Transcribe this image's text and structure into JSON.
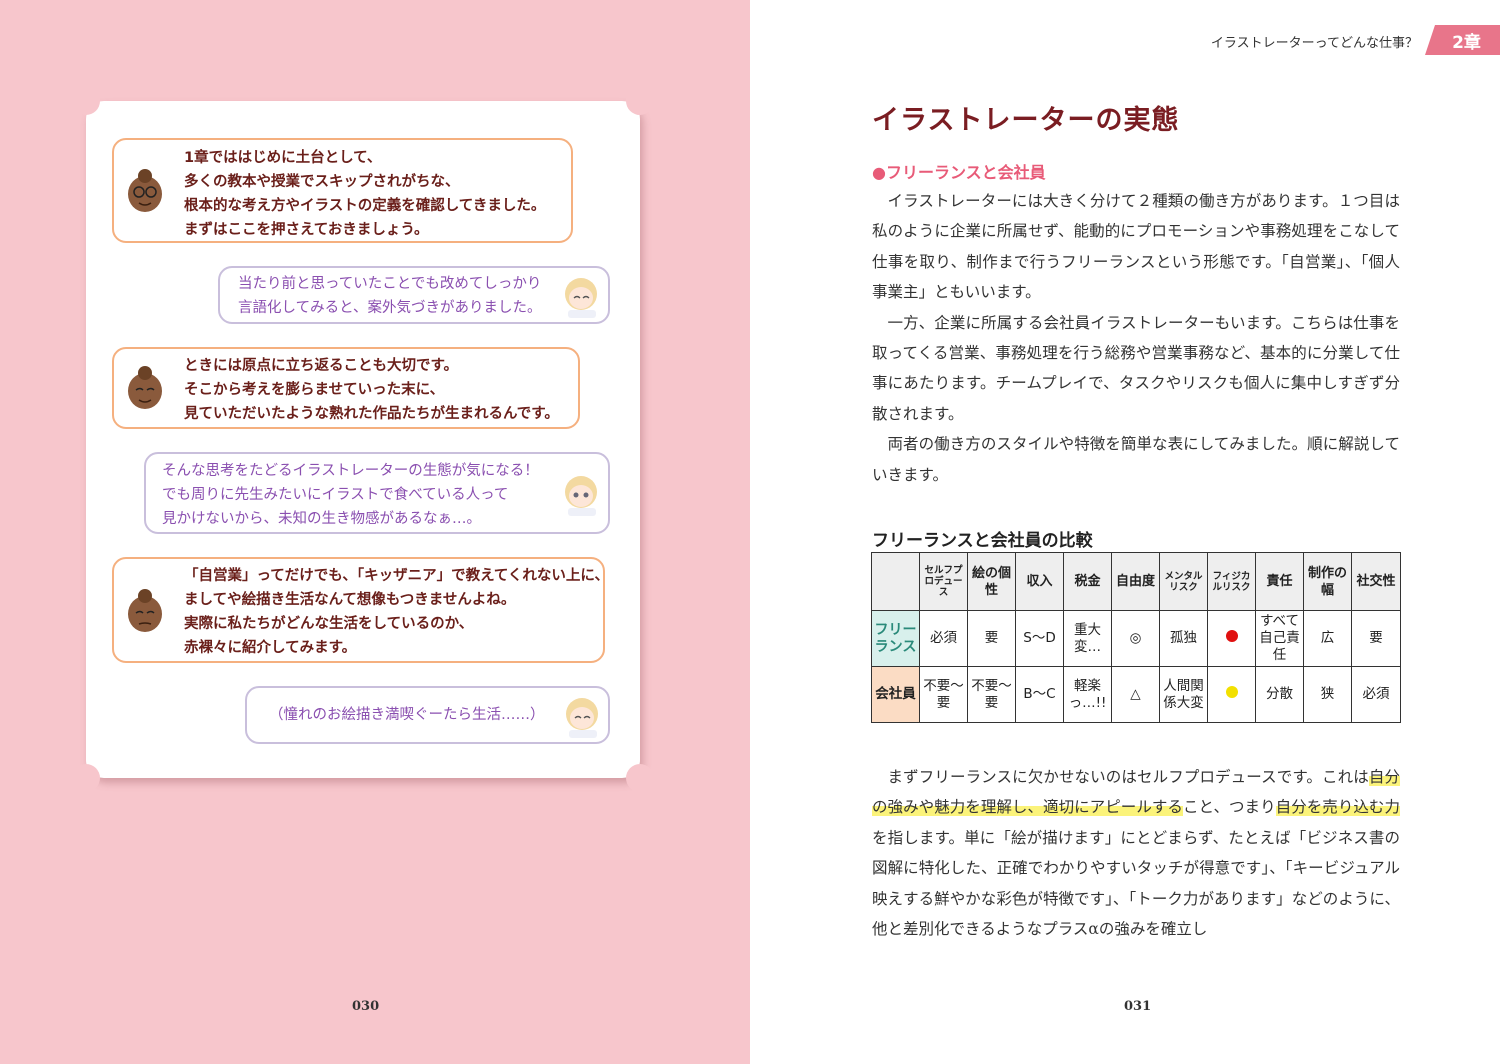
{
  "left_page": {
    "page_number": "030",
    "dialogue": [
      {
        "speaker": "teacher",
        "lines": "1章でははじめに土台として、\n多くの教本や授業でスキップされがちな、\n根本的な考え方やイラストの定義を確認してきました。\nまずはここを押さえておきましょう。"
      },
      {
        "speaker": "student",
        "lines": "当たり前と思っていたことでも改めてしっかり\n言語化してみると、案外気づきがありました。"
      },
      {
        "speaker": "teacher",
        "lines": "ときには原点に立ち返ることも大切です。\nそこから考えを膨らませていった末に、\n見ていただいたような熟れた作品たちが生まれるんです。"
      },
      {
        "speaker": "student",
        "lines": "そんな思考をたどるイラストレーターの生態が気になる！\nでも周りに先生みたいにイラストで食べている人って\n見かけないから、未知の生き物感があるなぁ…。"
      },
      {
        "speaker": "teacher",
        "lines": "「自営業」ってだけでも、「キッザニア」で教えてくれない上に、\nましてや絵描き生活なんて想像もつきませんよね。\n実際に私たちがどんな生活をしているのか、\n赤裸々に紹介してみます。"
      },
      {
        "speaker": "student",
        "lines": "（憧れのお絵描き満喫ぐーたら生活……）"
      }
    ]
  },
  "right_page": {
    "page_number": "031",
    "header": "イラストレーターってどんな仕事？",
    "chapter_tab": "2章",
    "section_title": "イラストレーターの実態",
    "subhead": "●フリーランスと会社員",
    "paragraphs": [
      "イラストレーターには大きく分けて２種類の働き方があります。１つ目は私のように企業に所属せず、能動的にプロモーションや事務処理をこなして仕事を取り、制作まで行うフリーランスという形態です。「自営業」、「個人事業主」ともいいます。",
      "一方、企業に所属する会社員イラストレーターもいます。こちらは仕事を取ってくる営業、事務処理を行う総務や営業事務など、基本的に分業して仕事にあたります。チームプレイで、タスクやリスクも個人に集中しすぎず分散されます。",
      "両者の働き方のスタイルや特徴を簡単な表にしてみました。順に解説していきます。"
    ],
    "table": {
      "title": "フリーランスと会社員の比較",
      "headers": [
        "セルフプロデュース",
        "絵の個性",
        "収入",
        "税金",
        "自由度",
        "メンタルリスク",
        "フィジカルリスク",
        "責任",
        "制作の幅",
        "社交性"
      ],
      "rows": [
        {
          "label": "フリーランス",
          "cells": [
            "必須",
            "要",
            "S〜D",
            "重大変…",
            "◎",
            "孤独",
            "",
            "すべて自己責任",
            "広",
            "要"
          ],
          "physical_dot": "#e01010"
        },
        {
          "label": "会社員",
          "cells": [
            "不要〜要",
            "不要〜要",
            "B〜C",
            "軽楽っ…!!",
            "△",
            "人間関係大変",
            "",
            "分散",
            "狭",
            "必須"
          ],
          "physical_dot": "#f2e000"
        }
      ]
    },
    "after_table": {
      "p1_a": "まずフリーランスに欠かせないのはセルフプロデュースです。これは",
      "p1_hl1": "自分の強みや魅力を理解し、適切にアピールする",
      "p1_b": "こと、つまり",
      "p1_hl2": "自分を売り込む力",
      "p1_c": "を指します。単に「絵が描けます」にとどまらず、たとえば「ビジネス書の図解に特化した、正確でわかりやすいタッチが得意です」、「キービジュアル映えする鮮やかな彩色が特徴です」、「トーク力があります」などのように、他と差別化できるようなプラスαの強みを確立し"
    }
  },
  "colors": {
    "left_bg": "#f7c6cc",
    "accent_pink": "#e8758a",
    "title_red": "#7a1d22",
    "teacher_border": "#f5b07f",
    "student_border": "#c9bfdc"
  }
}
